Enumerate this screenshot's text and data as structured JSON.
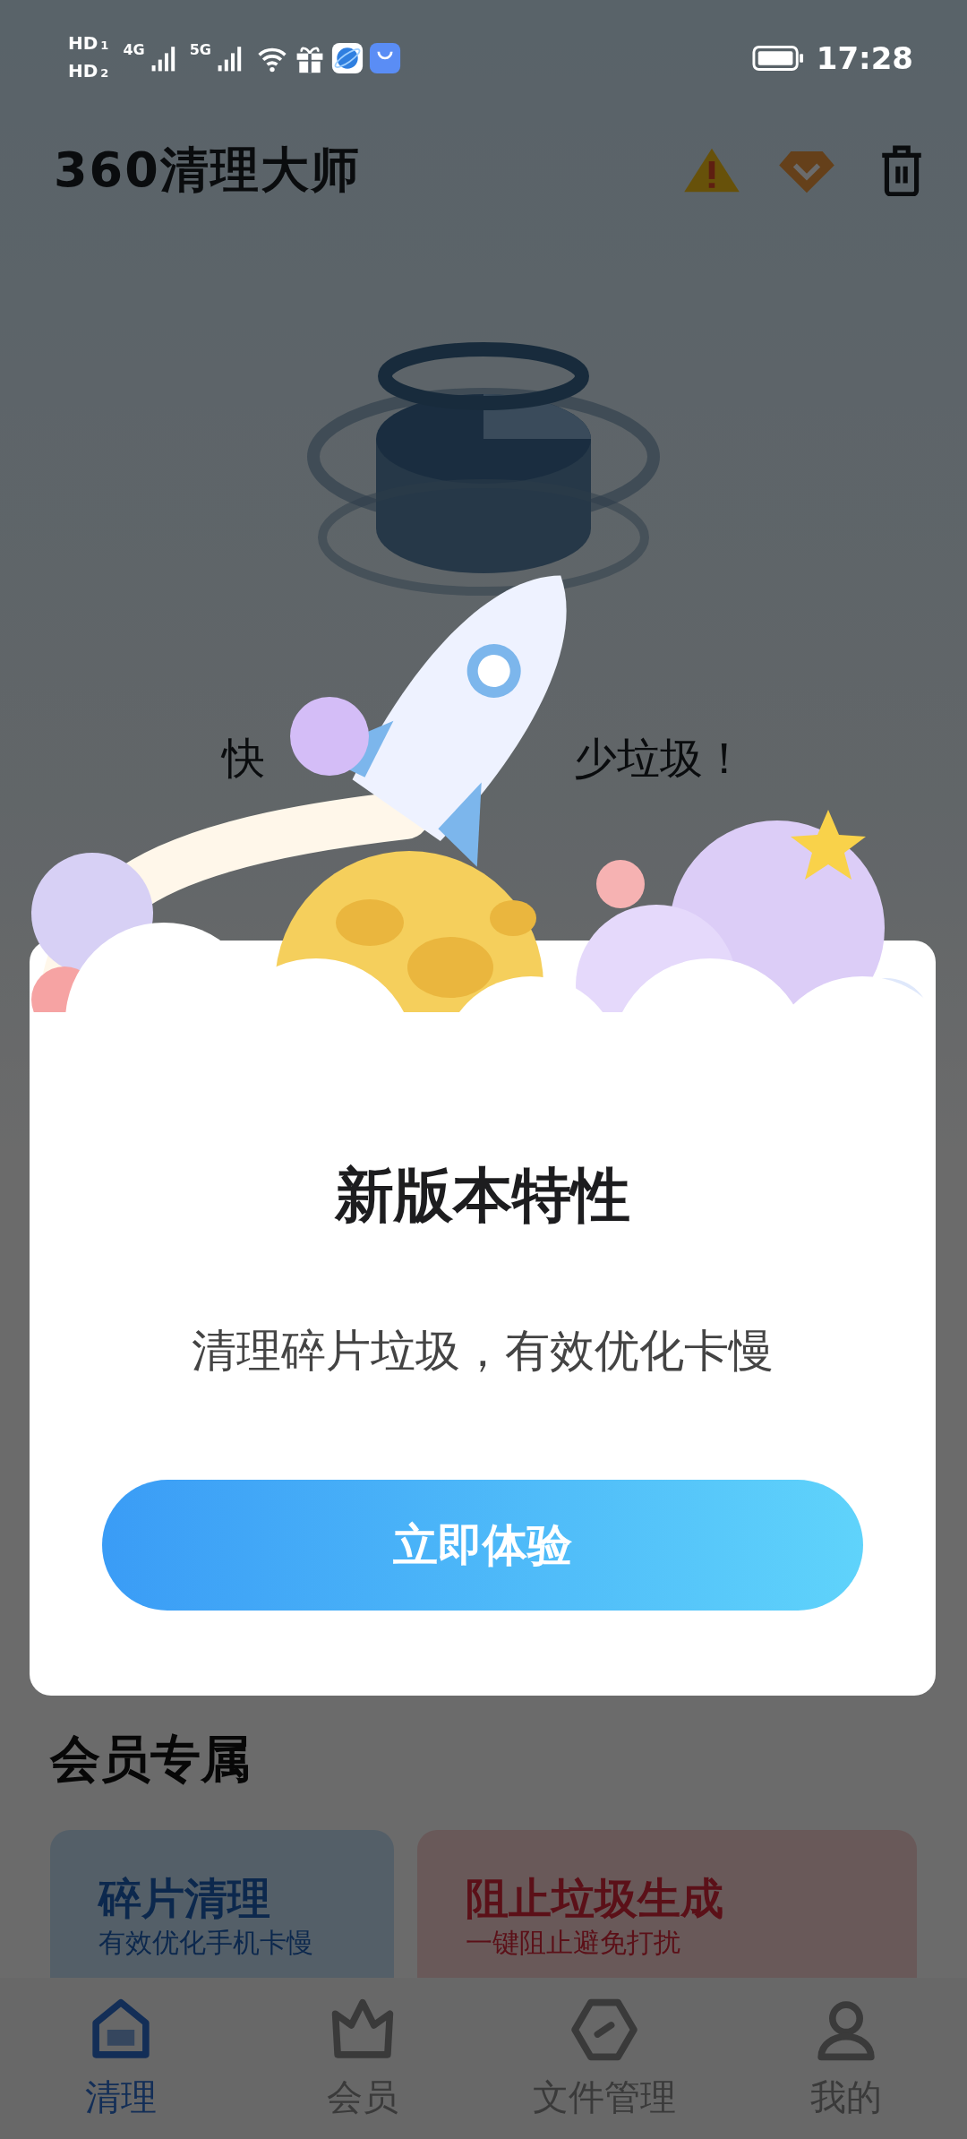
{
  "status_bar": {
    "sims": [
      {
        "label": "HD",
        "slot": "1"
      },
      {
        "label": "HD",
        "slot": "2"
      }
    ],
    "networks": [
      "4G",
      "5G"
    ],
    "time": "17:28"
  },
  "header": {
    "logo": "360清理大师"
  },
  "hero": {
    "tagline_start": "快",
    "tagline_end": "少垃圾！"
  },
  "member_section": {
    "title": "会员专属",
    "cards": [
      {
        "title": "碎片清理",
        "subtitle": "有效优化手机卡慢",
        "kind": "blue"
      },
      {
        "title": "阻止垃圾生成",
        "subtitle": "一键阻止避免打扰",
        "kind": "red"
      }
    ]
  },
  "bottom_nav": [
    {
      "label": "清理",
      "selected": true
    },
    {
      "label": "会员",
      "selected": false
    },
    {
      "label": "文件管理",
      "selected": false
    },
    {
      "label": "我的",
      "selected": false
    }
  ],
  "dialog": {
    "title": "新版本特性",
    "description": "清理碎片垃圾，有效优化卡慢",
    "button": "立即体验"
  }
}
